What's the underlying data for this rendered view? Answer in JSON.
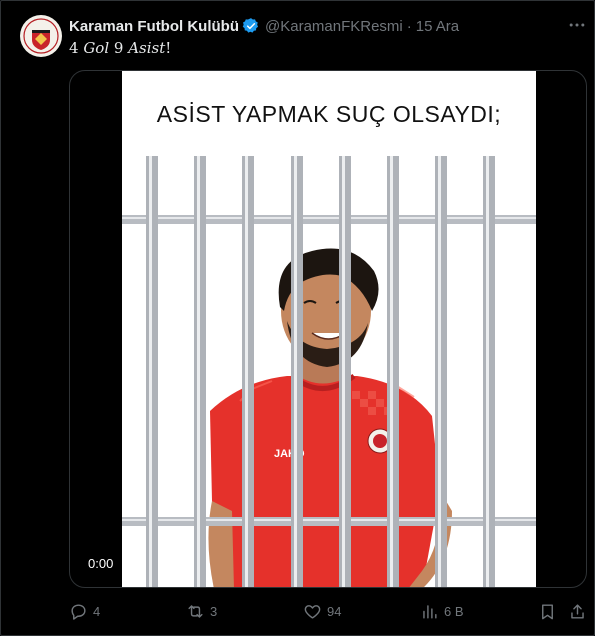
{
  "tweet": {
    "display_name": "Karaman Futbol Kulübü",
    "verified_icon": "verified-badge-icon",
    "handle": "@KaramanFKResmi",
    "separator": "·",
    "time": "15 Ara",
    "more_icon": "more-options-icon",
    "text": {
      "part1": "4 ",
      "word1": "Gol",
      "part2": " 9 ",
      "word2": "Asist",
      "part3": "!"
    }
  },
  "avatar": {
    "logo_text_top": "KARAMAN",
    "logo_text_bottom": "FUTBOL KULÜBÜ",
    "logo_year": "1981"
  },
  "media": {
    "caption": "ASİST YAPMAK SUÇ OLSAYDI;",
    "timecode": "0:00",
    "jersey_text": "JAKO"
  },
  "actions": {
    "reply": {
      "icon": "reply-icon",
      "count": "4"
    },
    "retweet": {
      "icon": "retweet-icon",
      "count": "3"
    },
    "like": {
      "icon": "like-icon",
      "count": "94"
    },
    "views": {
      "icon": "views-icon",
      "count": "6 B"
    },
    "bookmark": {
      "icon": "bookmark-icon"
    },
    "share": {
      "icon": "share-icon"
    }
  },
  "colors": {
    "background": "#000000",
    "text_primary": "#e7e9ea",
    "text_secondary": "#71767b",
    "verified_blue": "#1d9bf0",
    "jersey_red": "#e5312b",
    "bars": "#b8bcc2"
  }
}
